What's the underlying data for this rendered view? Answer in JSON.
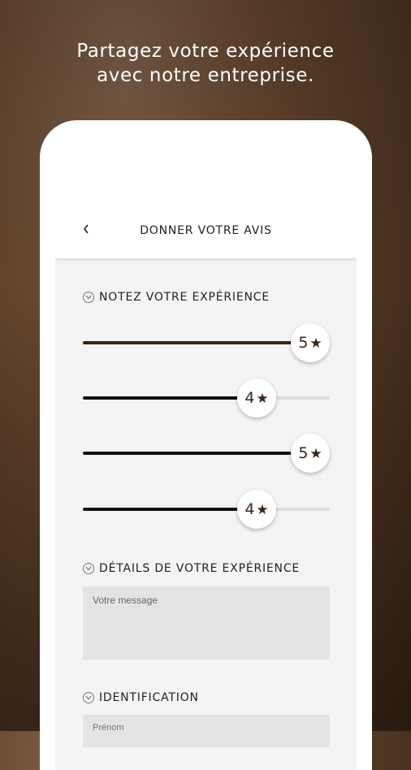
{
  "headline": {
    "line1": "Partagez votre expérience",
    "line2": "avec notre entreprise."
  },
  "app_bar": {
    "title": "DONNER VOTRE AVIS",
    "back_icon": "chevron-left-icon"
  },
  "sections": {
    "rating": {
      "title": "NOTEZ VOTRE EXPÉRIENCE"
    },
    "details": {
      "title": "DÉTAILS DE VOTRE EXPÉRIENCE"
    },
    "identification": {
      "title": "IDENTIFICATION"
    }
  },
  "ratings": [
    {
      "value": 5,
      "max": 5,
      "label": "5",
      "fill_color": "#3a2418"
    },
    {
      "value": 4,
      "max": 5,
      "label": "4",
      "fill_color": "#111111"
    },
    {
      "value": 5,
      "max": 5,
      "label": "5",
      "fill_color": "#111111"
    },
    {
      "value": 4,
      "max": 5,
      "label": "4",
      "fill_color": "#111111"
    }
  ],
  "message_input": {
    "placeholder": "Votre message",
    "value": ""
  },
  "firstname_input": {
    "placeholder": "Prénom"
  },
  "colors": {
    "accent": "#3a2418",
    "star": "#3a2418"
  }
}
